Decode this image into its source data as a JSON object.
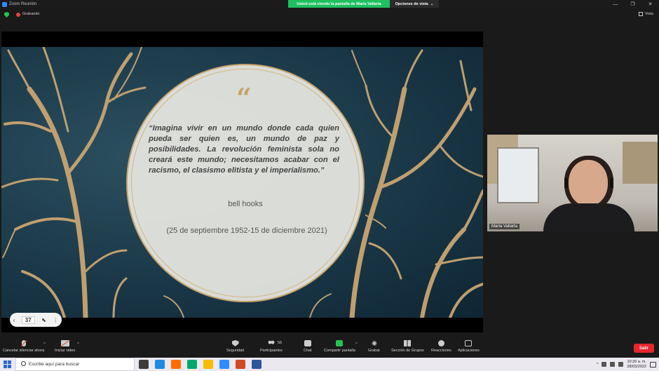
{
  "titlebar": {
    "title": "Zoom Reunión",
    "share_banner": "Usted está viendo la pantalla de María Vallarta",
    "view_options": "Opciones de vista",
    "win_minimize": "—",
    "win_restore": "❐",
    "win_close": "✕"
  },
  "status": {
    "recording_label": "Grabando",
    "view_label": "Vista"
  },
  "slide": {
    "quote_mark": "“",
    "quote": "“Imagina vivir en un mundo donde cada quien pueda ser quien es, un mundo de paz y posibilidades. La revolución feminista sola no creará este mundo; necesitamos acabar con el racismo, el clasismo elitista y el imperialismo.”",
    "author": "bell hooks",
    "dates": "(25 de septiembre 1952-15 de diciembre 2021)",
    "colors": {
      "background": "#1a3848",
      "gold": "#c7a46a",
      "circle": "#e8e8e2"
    }
  },
  "slide_nav": {
    "prev": "‹",
    "page": "37",
    "cursor": "⬉",
    "more": "⋮"
  },
  "video": {
    "participant_name": "María Vallarta"
  },
  "toolbar": {
    "mute_label": "Cancelar silenciar ahora",
    "video_label": "Iniciar video",
    "security_label": "Seguridad",
    "participants_label": "Participantes",
    "participants_count": "56",
    "chat_label": "Chat",
    "share_label": "Compartir pantalla",
    "record_label": "Grabar",
    "breakout_label": "Sección de Grupos",
    "reactions_label": "Reacciones",
    "apps_label": "Aplicaciones",
    "leave_label": "Salir",
    "caret": "^"
  },
  "taskbar": {
    "search_placeholder": "Escribe aquí para buscar",
    "time": "10:26 a. m.",
    "date": "28/03/2022",
    "tray_caret": "^",
    "app_icon_colors": [
      "#3b3b3b",
      "#1e88e5",
      "#ff6d00",
      "#00a86b",
      "#fbbc05",
      "#2d8cff",
      "#d24726",
      "#2b579a"
    ]
  }
}
